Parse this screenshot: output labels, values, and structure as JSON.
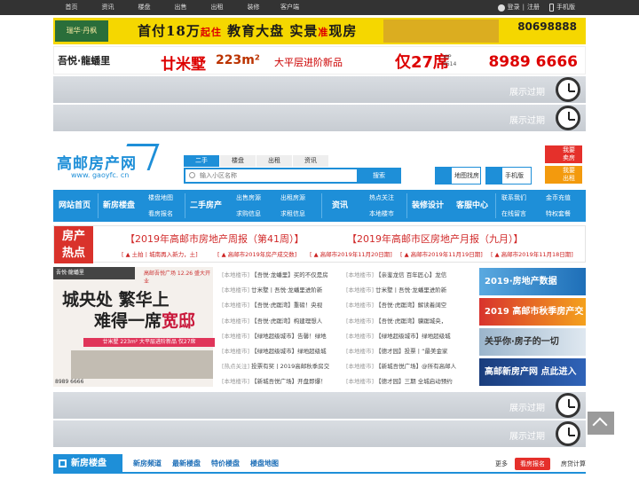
{
  "topbar": {
    "nav": [
      "首页",
      "资讯",
      "楼盘",
      "出售",
      "出租",
      "装修",
      "客户端"
    ],
    "login": "登录",
    "sep": "|",
    "register": "注册",
    "mobile": "手机版"
  },
  "ad1": {
    "logo": "瑞华·丹枫",
    "slogan_a": "首付18万",
    "slogan_small": "起住",
    "slogan_b": "教育大盘 实景",
    "slogan_small2": "准",
    "slogan_c": "现房",
    "phone": "80698888"
  },
  "ad2": {
    "brand": "吾悦·龍蟠里",
    "title": "廿米墅",
    "area": "223m²",
    "desc": "大平层进阶新品",
    "price": "仅27席",
    "vip": "VIP\n0514",
    "phone": "8989 6666"
  },
  "expired_text": "展示过期",
  "logo": {
    "name": "高邮房产网",
    "url": "www. gaoyfc. cn"
  },
  "search": {
    "tabs": [
      "二手",
      "楼盘",
      "出租",
      "资讯"
    ],
    "placeholder": "输入小区名称",
    "button": "搜索",
    "map": "地图找房",
    "mobile": "手机版",
    "cta1": "我要\n卖房",
    "cta2": "我要\n出租"
  },
  "mainnav": {
    "home": "网站首页",
    "newhouse": "新房楼盘",
    "map": "楼盘地图",
    "reg": "看房报名",
    "second": "二手房产",
    "sale": "出售房源",
    "buy": "求购信息",
    "rent": "出租房源",
    "rentreq": "求租信息",
    "news": "资讯",
    "hot": "热点关注",
    "local": "本地楼市",
    "deco": "装修设计",
    "service": "客服中心",
    "contact": "联系我们",
    "online": "在线留言",
    "recharge": "金币充值",
    "vip": "特权套餐"
  },
  "news": {
    "tag": "房产\n热点",
    "headline1": "【2019年高邮市房地产周报（第41周）】",
    "headline2": "【2019年高邮市区房地产月报（九月）】",
    "sub": [
      "[ ▲ 土拍丨城南再入新力，土]",
      "[ ▲ 高邮市2019年房产成交数]",
      "[ ▲ 高邮市2019年11月20日期]",
      "[ ▲ 高邮市2019年11月19日期]",
      "[ ▲ 高邮市2019年11月18日期]"
    ]
  },
  "promo": {
    "brand": "吾悦·龍蟠里",
    "note": "高邮吾悦广场 12.26 盛大开业",
    "line1": "城央处 繁华上",
    "line2a": "难得一席",
    "line2b": "宽邸",
    "strip": "廿米墅 223m² 大平层进阶新品 仅27席",
    "phone": "8989 6666"
  },
  "list_left": [
    [
      "[本地楼市]",
      "【吾悦·龙蟠里】买的不仅是房"
    ],
    [
      "[本地楼市]",
      "廿米墅丨吾悦·龙蟠里进阶新"
    ],
    [
      "[本地楼市]",
      "【吾悦·虎踞湾】重磅！央视"
    ],
    [
      "[本地楼市]",
      "【吾悦·虎踞湾】构建理想人"
    ],
    [
      "[本地楼市]",
      "【绿地超级城市】告馨！绿地"
    ],
    [
      "[本地楼市]",
      "【绿地超级城市】绿地超级城"
    ],
    [
      "[热点关注]",
      "投票有奖丨2019高邮秋季房交"
    ],
    [
      "[本地楼市]",
      "【新城吾悦广场】开盘即爆！"
    ]
  ],
  "list_right": [
    [
      "[本地楼市]",
      "【亲鉴龙信 百年匠心】龙信"
    ],
    [
      "[本地楼市]",
      "廿米墅丨吾悦·龙蟠里进阶新"
    ],
    [
      "[本地楼市]",
      "【吾悦·虎踞湾】解读着阔空"
    ],
    [
      "[本地楼市]",
      "【吾悦·虎踞湾】骥踞城央，"
    ],
    [
      "[本地楼市]",
      "【绿地超级城市】绿地超级城"
    ],
    [
      "[本地楼市]",
      "【德才园】投票丨“最美金家"
    ],
    [
      "[本地楼市]",
      "【新城吾悦广场】@所有高邮人"
    ],
    [
      "[本地楼市]",
      "【德才园】三期 全城启动预约"
    ]
  ],
  "rightads": [
    "2019·房地产数据",
    "2019 高邮市秋季房产交易会",
    "关乎你·房子的一切",
    "高邮新房产网 点此进入"
  ],
  "section": {
    "title": "新房楼盘",
    "tabs": [
      "新房频道",
      "最新楼盘",
      "特价楼盘",
      "楼盘地图"
    ],
    "more": "更多",
    "register": "看房报名",
    "calc": "房贷计算"
  }
}
